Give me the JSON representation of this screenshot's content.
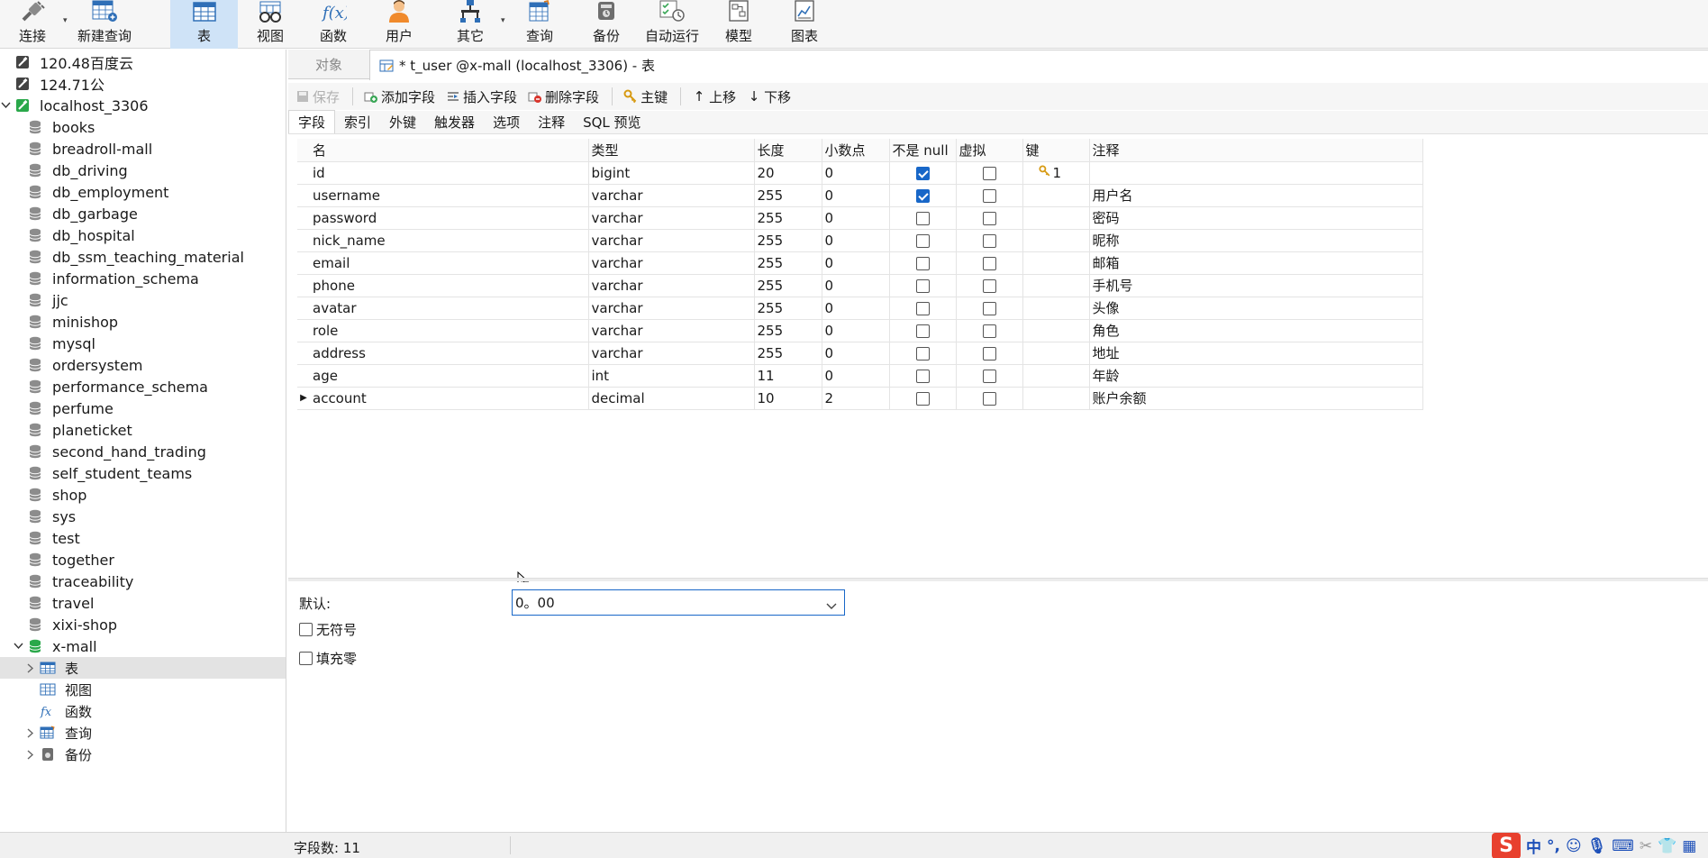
{
  "toolbar": {
    "items": [
      {
        "label": "连接",
        "icon": "connect-icon"
      },
      {
        "label": "新建查询",
        "icon": "new-query-icon"
      },
      {
        "label": "表",
        "icon": "table-icon",
        "active": true
      },
      {
        "label": "视图",
        "icon": "view-icon"
      },
      {
        "label": "函数",
        "icon": "function-icon"
      },
      {
        "label": "用户",
        "icon": "user-icon"
      },
      {
        "label": "其它",
        "icon": "other-icon"
      },
      {
        "label": "查询",
        "icon": "query-icon"
      },
      {
        "label": "备份",
        "icon": "backup-icon"
      },
      {
        "label": "自动运行",
        "icon": "automation-icon"
      },
      {
        "label": "模型",
        "icon": "model-icon"
      },
      {
        "label": "图表",
        "icon": "chart-icon"
      }
    ]
  },
  "navigator": {
    "connections": [
      {
        "label": "120.48百度云"
      },
      {
        "label": "124.71公"
      },
      {
        "label": "localhost_3306"
      }
    ],
    "databases": [
      "books",
      "breadroll-mall",
      "db_driving",
      "db_employment",
      "db_garbage",
      "db_hospital",
      "db_ssm_teaching_material",
      "information_schema",
      "jjc",
      "minishop",
      "mysql",
      "ordersystem",
      "performance_schema",
      "perfume",
      "planeticket",
      "second_hand_trading",
      "self_student_teams",
      "shop",
      "sys",
      "test",
      "together",
      "traceability",
      "travel",
      "xixi-shop",
      "x-mall"
    ],
    "xmall_children": [
      {
        "label": "表"
      },
      {
        "label": "视图"
      },
      {
        "label": "函数"
      },
      {
        "label": "查询"
      },
      {
        "label": "备份"
      }
    ]
  },
  "tabs": {
    "object": "对象",
    "active": "* t_user @x-mall (localhost_3306) - 表"
  },
  "actions": {
    "save": "保存",
    "add_field": "添加字段",
    "insert_field": "插入字段",
    "delete_field": "删除字段",
    "primary_key": "主键",
    "move_up": "上移",
    "move_down": "下移"
  },
  "subtabs": [
    "字段",
    "索引",
    "外键",
    "触发器",
    "选项",
    "注释",
    "SQL 预览"
  ],
  "grid": {
    "columns": [
      "名",
      "类型",
      "长度",
      "小数点",
      "不是 null",
      "虚拟",
      "键",
      "注释"
    ],
    "rows": [
      {
        "name": "id",
        "type": "bigint",
        "length": "20",
        "decimals": "0",
        "not_null": true,
        "virtual": false,
        "key": "1",
        "comment": ""
      },
      {
        "name": "username",
        "type": "varchar",
        "length": "255",
        "decimals": "0",
        "not_null": true,
        "virtual": false,
        "key": "",
        "comment": "用户名"
      },
      {
        "name": "password",
        "type": "varchar",
        "length": "255",
        "decimals": "0",
        "not_null": false,
        "virtual": false,
        "key": "",
        "comment": "密码"
      },
      {
        "name": "nick_name",
        "type": "varchar",
        "length": "255",
        "decimals": "0",
        "not_null": false,
        "virtual": false,
        "key": "",
        "comment": "昵称"
      },
      {
        "name": "email",
        "type": "varchar",
        "length": "255",
        "decimals": "0",
        "not_null": false,
        "virtual": false,
        "key": "",
        "comment": "邮箱"
      },
      {
        "name": "phone",
        "type": "varchar",
        "length": "255",
        "decimals": "0",
        "not_null": false,
        "virtual": false,
        "key": "",
        "comment": "手机号"
      },
      {
        "name": "avatar",
        "type": "varchar",
        "length": "255",
        "decimals": "0",
        "not_null": false,
        "virtual": false,
        "key": "",
        "comment": "头像"
      },
      {
        "name": "role",
        "type": "varchar",
        "length": "255",
        "decimals": "0",
        "not_null": false,
        "virtual": false,
        "key": "",
        "comment": "角色"
      },
      {
        "name": "address",
        "type": "varchar",
        "length": "255",
        "decimals": "0",
        "not_null": false,
        "virtual": false,
        "key": "",
        "comment": "地址"
      },
      {
        "name": "age",
        "type": "int",
        "length": "11",
        "decimals": "0",
        "not_null": false,
        "virtual": false,
        "key": "",
        "comment": "年龄"
      },
      {
        "name": "account",
        "type": "decimal",
        "length": "10",
        "decimals": "2",
        "not_null": false,
        "virtual": false,
        "key": "",
        "comment": "账户余额",
        "current": true
      }
    ]
  },
  "props": {
    "default_label": "默认:",
    "default_value": "0。00",
    "unsigned_label": "无符号",
    "unsigned_checked": false,
    "zerofill_label": "填充零",
    "zerofill_checked": false
  },
  "status": {
    "field_count": "字段数: 11"
  },
  "colors": {
    "accent": "#1867c8",
    "active_toolbar": "#cfe3f7",
    "db_active": "#2aa84a",
    "ime": "#e8402e"
  }
}
